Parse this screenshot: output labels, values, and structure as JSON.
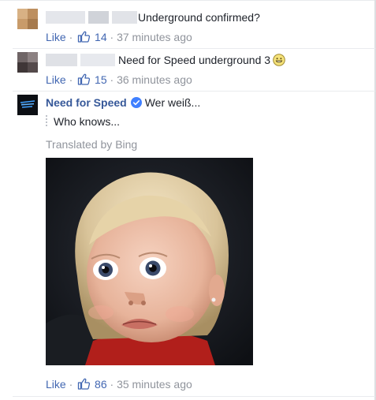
{
  "comments": [
    {
      "text": "Underground confirmed?",
      "like_label": "Like",
      "likes": "14",
      "separator": "·",
      "time": "37 minutes ago"
    },
    {
      "text": "Need for Speed underground 3",
      "like_label": "Like",
      "likes": "15",
      "separator": "·",
      "time": "36 minutes ago"
    }
  ],
  "reply": {
    "author": "Need for Speed",
    "text": "Wer weiß...",
    "translation": "Who knows...",
    "translated_by": "Translated by Bing",
    "like_label": "Like",
    "likes": "86",
    "separator": "·",
    "time": "35 minutes ago"
  },
  "icons": {
    "like": "thumbs-up-icon",
    "verified": "verified-badge-icon",
    "emoji": "grinning-face-icon"
  },
  "colors": {
    "link": "#4267b2",
    "author": "#365899",
    "meta": "#90949c",
    "verified": "#4080ff"
  }
}
